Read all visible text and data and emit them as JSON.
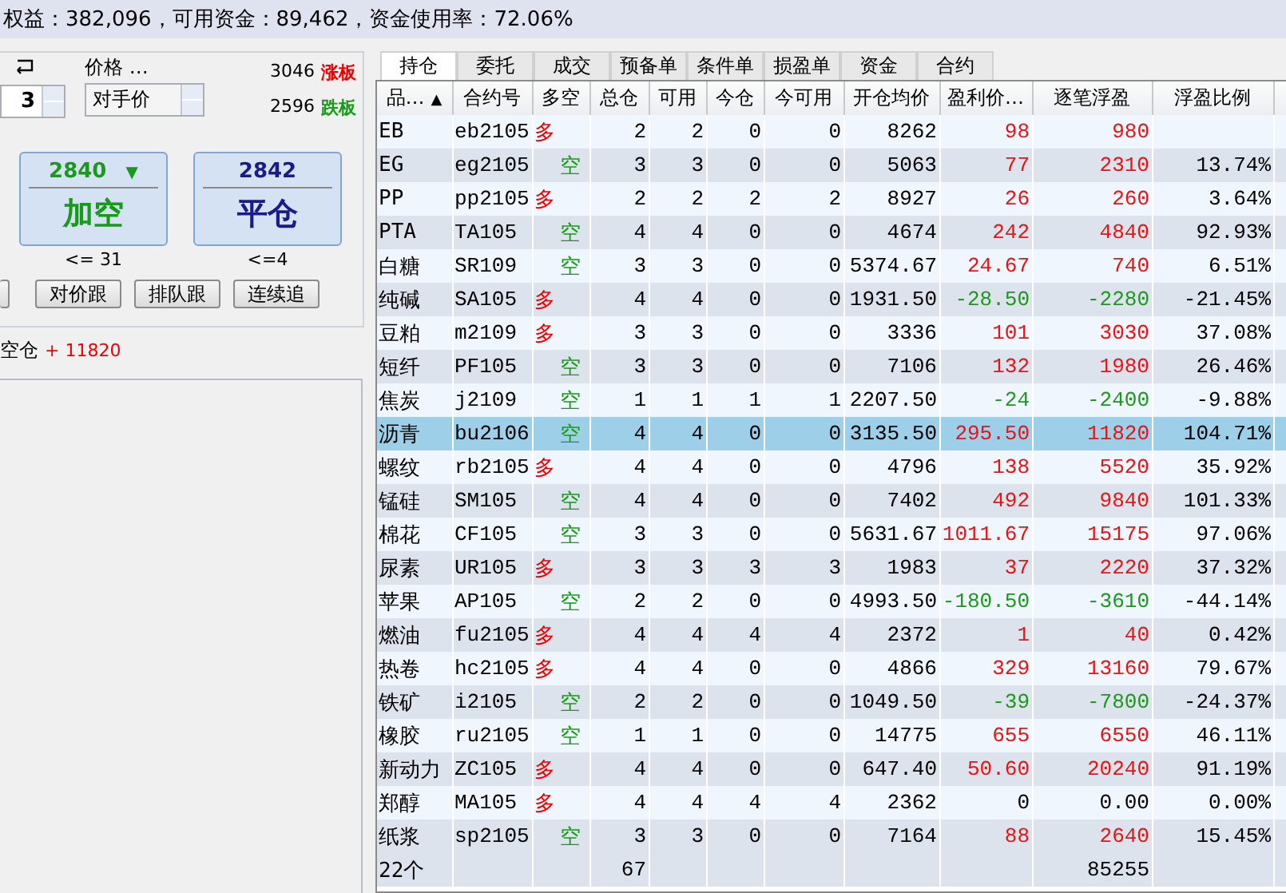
{
  "summary_bar": {
    "text": "权益：382,096，可用资金：89,462，资金使用率：72.06%"
  },
  "order_panel": {
    "price_label": "价格 …",
    "quantity": "3",
    "price_type": "对手价",
    "limit_up": {
      "price": "3046",
      "label": "涨板"
    },
    "limit_down": {
      "price": "2596",
      "label": "跌板"
    },
    "action_buttons": [
      {
        "kind": "short",
        "price": "2840",
        "arrow": "▼",
        "label": "加空",
        "limit": "<= 31"
      },
      {
        "kind": "close",
        "price": "2842",
        "label": "平仓",
        "limit": "<=4"
      }
    ],
    "follow_buttons": [
      "对价跟",
      "排队跟",
      "连续追"
    ],
    "position_note": {
      "label": "空仓",
      "sign": "+",
      "amount": "11820"
    }
  },
  "tabs": [
    {
      "label": "持仓",
      "selected": true
    },
    {
      "label": "委托",
      "selected": false
    },
    {
      "label": "成交",
      "selected": false
    },
    {
      "label": "预备单",
      "selected": false
    },
    {
      "label": "条件单",
      "selected": false
    },
    {
      "label": "损盈单",
      "selected": false
    },
    {
      "label": "资金",
      "selected": false
    },
    {
      "label": "合约",
      "selected": false
    }
  ],
  "table": {
    "columns": [
      {
        "label": "品…",
        "sort_arrow": "▲"
      },
      {
        "label": "合约号"
      },
      {
        "label": "多空"
      },
      {
        "label": "总仓"
      },
      {
        "label": "可用"
      },
      {
        "label": "今仓"
      },
      {
        "label": "今可用"
      },
      {
        "label": "开仓均价"
      },
      {
        "label": "盈利价…"
      },
      {
        "label": "逐笔浮盈"
      },
      {
        "label": "浮盈比例"
      }
    ],
    "rows": [
      {
        "product": "EB",
        "contract": "eb2105",
        "side": "多",
        "kind": "long",
        "total": "2",
        "available": "2",
        "today": "0",
        "today_available": "0",
        "open_avg": "8262",
        "profit_price": "98",
        "float_pnl": "980",
        "color": "#ee1111",
        "selected": false
      },
      {
        "product": "EG",
        "contract": "eg2105",
        "side": "空",
        "kind": "short",
        "total": "3",
        "available": "3",
        "today": "0",
        "today_available": "0",
        "open_avg": "5063",
        "profit_price": "77",
        "float_pnl": "2310",
        "pnl_ratio": "13.74%",
        "color": "#ee1111",
        "selected": false
      },
      {
        "product": "PP",
        "contract": "pp2105",
        "side": "多",
        "kind": "long",
        "total": "2",
        "available": "2",
        "today": "2",
        "today_available": "2",
        "open_avg": "8927",
        "profit_price": "26",
        "float_pnl": "260",
        "pnl_ratio": "3.64%",
        "color": "#ee1111",
        "selected": false
      },
      {
        "product": "PTA",
        "contract": "TA105",
        "side": "空",
        "kind": "short",
        "total": "4",
        "available": "4",
        "today": "0",
        "today_available": "0",
        "open_avg": "4674",
        "profit_price": "242",
        "float_pnl": "4840",
        "pnl_ratio": "92.93%",
        "color": "#ee1111",
        "selected": false
      },
      {
        "product": "白糖",
        "contract": "SR109",
        "side": "空",
        "kind": "short",
        "total": "3",
        "available": "3",
        "today": "0",
        "today_available": "0",
        "open_avg": "5374.67",
        "profit_price": "24.67",
        "float_pnl": "740",
        "pnl_ratio": "6.51%",
        "color": "#ee1111",
        "selected": false
      },
      {
        "product": "纯碱",
        "contract": "SA105",
        "side": "多",
        "kind": "long",
        "total": "4",
        "available": "4",
        "today": "0",
        "today_available": "0",
        "open_avg": "1931.50",
        "profit_price": "-28.50",
        "float_pnl": "-2280",
        "pnl_ratio": "-21.45%",
        "color": "#1a9a1a",
        "selected": false
      },
      {
        "product": "豆粕",
        "contract": "m2109",
        "side": "多",
        "kind": "long",
        "total": "3",
        "available": "3",
        "today": "0",
        "today_available": "0",
        "open_avg": "3336",
        "profit_price": "101",
        "float_pnl": "3030",
        "pnl_ratio": "37.08%",
        "color": "#ee1111",
        "selected": false
      },
      {
        "product": "短纤",
        "contract": "PF105",
        "side": "空",
        "kind": "short",
        "total": "3",
        "available": "3",
        "today": "0",
        "today_available": "0",
        "open_avg": "7106",
        "profit_price": "132",
        "float_pnl": "1980",
        "pnl_ratio": "26.46%",
        "color": "#ee1111",
        "selected": false
      },
      {
        "product": "焦炭",
        "contract": "j2109",
        "side": "空",
        "kind": "short",
        "total": "1",
        "available": "1",
        "today": "1",
        "today_available": "1",
        "open_avg": "2207.50",
        "profit_price": "-24",
        "float_pnl": "-2400",
        "pnl_ratio": "-9.88%",
        "color": "#1a9a1a",
        "selected": false
      },
      {
        "product": "沥青",
        "contract": "bu2106",
        "side": "空",
        "kind": "short",
        "total": "4",
        "available": "4",
        "today": "0",
        "today_available": "0",
        "open_avg": "3135.50",
        "profit_price": "295.50",
        "float_pnl": "11820",
        "pnl_ratio": "104.71%",
        "color": "#ee1111",
        "selected": true
      },
      {
        "product": "螺纹",
        "contract": "rb2105",
        "side": "多",
        "kind": "long",
        "total": "4",
        "available": "4",
        "today": "0",
        "today_available": "0",
        "open_avg": "4796",
        "profit_price": "138",
        "float_pnl": "5520",
        "pnl_ratio": "35.92%",
        "color": "#ee1111",
        "selected": false
      },
      {
        "product": "锰硅",
        "contract": "SM105",
        "side": "空",
        "kind": "short",
        "total": "4",
        "available": "4",
        "today": "0",
        "today_available": "0",
        "open_avg": "7402",
        "profit_price": "492",
        "float_pnl": "9840",
        "pnl_ratio": "101.33%",
        "color": "#ee1111",
        "selected": false
      },
      {
        "product": "棉花",
        "contract": "CF105",
        "side": "空",
        "kind": "short",
        "total": "3",
        "available": "3",
        "today": "0",
        "today_available": "0",
        "open_avg": "5631.67",
        "profit_price": "1011.67",
        "float_pnl": "15175",
        "pnl_ratio": "97.06%",
        "color": "#ee1111",
        "selected": false
      },
      {
        "product": "尿素",
        "contract": "UR105",
        "side": "多",
        "kind": "long",
        "total": "3",
        "available": "3",
        "today": "3",
        "today_available": "3",
        "open_avg": "1983",
        "profit_price": "37",
        "float_pnl": "2220",
        "pnl_ratio": "37.32%",
        "color": "#ee1111",
        "selected": false
      },
      {
        "product": "苹果",
        "contract": "AP105",
        "side": "空",
        "kind": "short",
        "total": "2",
        "available": "2",
        "today": "0",
        "today_available": "0",
        "open_avg": "4993.50",
        "profit_price": "-180.50",
        "float_pnl": "-3610",
        "pnl_ratio": "-44.14%",
        "color": "#1a9a1a",
        "selected": false
      },
      {
        "product": "燃油",
        "contract": "fu2105",
        "side": "多",
        "kind": "long",
        "total": "4",
        "available": "4",
        "today": "4",
        "today_available": "4",
        "open_avg": "2372",
        "profit_price": "1",
        "float_pnl": "40",
        "pnl_ratio": "0.42%",
        "color": "#ee1111",
        "selected": false
      },
      {
        "product": "热卷",
        "contract": "hc2105",
        "side": "多",
        "kind": "long",
        "total": "4",
        "available": "4",
        "today": "0",
        "today_available": "0",
        "open_avg": "4866",
        "profit_price": "329",
        "float_pnl": "13160",
        "pnl_ratio": "79.67%",
        "color": "#ee1111",
        "selected": false
      },
      {
        "product": "铁矿",
        "contract": "i2105",
        "side": "空",
        "kind": "short",
        "total": "2",
        "available": "2",
        "today": "0",
        "today_available": "0",
        "open_avg": "1049.50",
        "profit_price": "-39",
        "float_pnl": "-7800",
        "pnl_ratio": "-24.37%",
        "color": "#1a9a1a",
        "selected": false
      },
      {
        "product": "橡胶",
        "contract": "ru2105",
        "side": "空",
        "kind": "short",
        "total": "1",
        "available": "1",
        "today": "0",
        "today_available": "0",
        "open_avg": "14775",
        "profit_price": "655",
        "float_pnl": "6550",
        "pnl_ratio": "46.11%",
        "color": "#ee1111",
        "selected": false
      },
      {
        "product": "新动力",
        "contract": "ZC105",
        "side": "多",
        "kind": "long",
        "total": "4",
        "available": "4",
        "today": "0",
        "today_available": "0",
        "open_avg": "647.40",
        "profit_price": "50.60",
        "float_pnl": "20240",
        "pnl_ratio": "91.19%",
        "color": "#ee1111",
        "selected": false
      },
      {
        "product": "郑醇",
        "contract": "MA105",
        "side": "多",
        "kind": "long",
        "total": "4",
        "available": "4",
        "today": "4",
        "today_available": "4",
        "open_avg": "2362",
        "profit_price": "0",
        "float_pnl": "0.00",
        "pnl_ratio": "0.00%",
        "color": "#000000",
        "selected": false
      },
      {
        "product": "纸浆",
        "contract": "sp2105",
        "side": "空",
        "kind": "short",
        "total": "3",
        "available": "3",
        "today": "0",
        "today_available": "0",
        "open_avg": "7164",
        "profit_price": "88",
        "float_pnl": "2640",
        "pnl_ratio": "15.45%",
        "color": "#ee1111",
        "selected": false
      }
    ],
    "totals": {
      "count": "22个",
      "total": "67",
      "float_pnl": "85255"
    }
  }
}
